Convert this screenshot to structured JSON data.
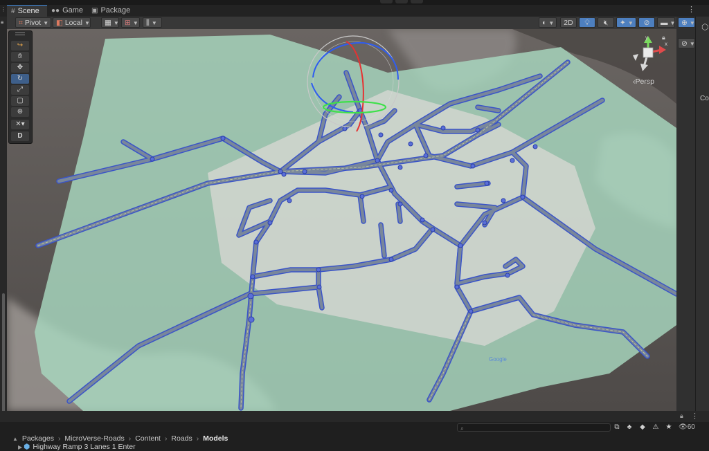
{
  "tabs": [
    {
      "label": "Scene",
      "icon": "grid-icon",
      "active": true
    },
    {
      "label": "Game",
      "icon": "gamepad-icon",
      "active": false
    },
    {
      "label": "Package Manager",
      "icon": "package-icon",
      "active": false
    }
  ],
  "toolbar": {
    "pivot_label": "Pivot",
    "local_label": "Local",
    "mode_2d_label": "2D"
  },
  "tools": {
    "debug_label": "D",
    "items": [
      "road-spline-tool-icon",
      "hand-icon",
      "move-icon",
      "rotate-icon",
      "scale-icon",
      "rect-icon",
      "transform-icon",
      "custom-tools-icon"
    ]
  },
  "viewport": {
    "camera_mode_label": "Persp",
    "watermark": "Google",
    "gizmo_axis_labels": {
      "y": "y",
      "x": "x"
    }
  },
  "bottom": {
    "visible_count": "60",
    "breadcrumbs": [
      "Packages",
      "MicroVerse-Roads",
      "Content",
      "Roads",
      "Models"
    ],
    "selected_asset": "Highway Ramp 3 Lanes 1 Enter"
  },
  "right_panel": {
    "partial_label": "Co"
  },
  "colors": {
    "accent": "#3b8eea",
    "road_outline": "#3a54c8",
    "road_fill": "#6f7c8f",
    "map_green": "#a5d6bd",
    "terrain": "#5b5652"
  }
}
